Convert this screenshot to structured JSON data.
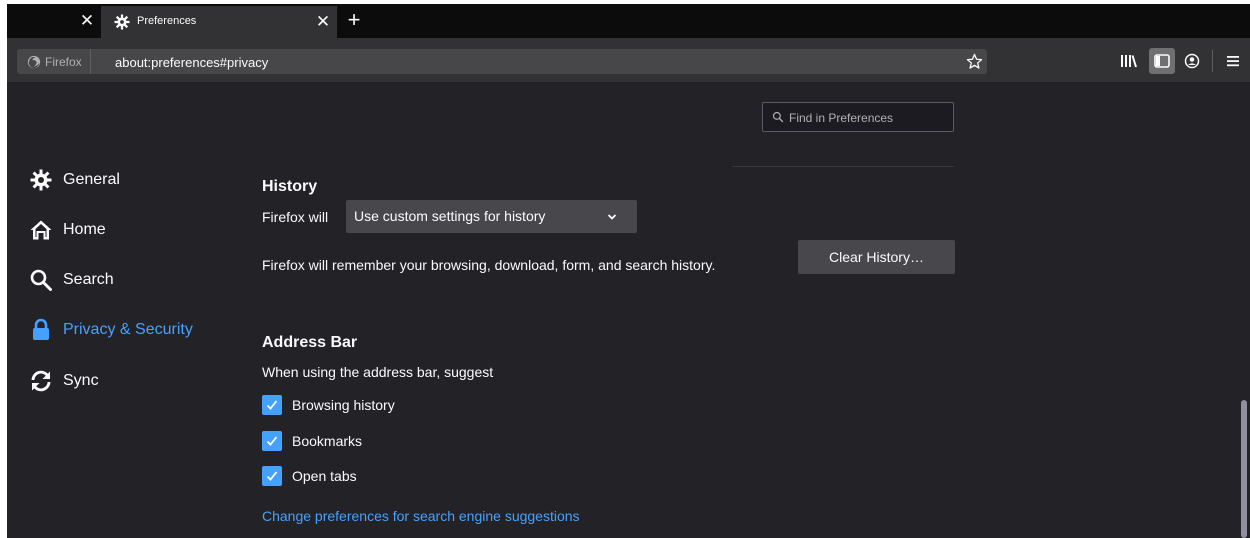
{
  "tabs": {
    "active_title": "Preferences"
  },
  "urlbar": {
    "identity_label": "Firefox",
    "url": "about:preferences#privacy"
  },
  "search": {
    "placeholder": "Find in Preferences"
  },
  "sidebar": {
    "items": [
      {
        "label": "General",
        "icon": "gear-icon"
      },
      {
        "label": "Home",
        "icon": "home-icon"
      },
      {
        "label": "Search",
        "icon": "search-icon"
      },
      {
        "label": "Privacy & Security",
        "icon": "lock-icon",
        "selected": true
      },
      {
        "label": "Sync",
        "icon": "sync-icon"
      }
    ]
  },
  "history": {
    "heading": "History",
    "firefox_will_label": "Firefox will",
    "mode_selected": "Use custom settings for history",
    "description": "Firefox will remember your browsing, download, form, and search history.",
    "clear_button": "Clear History…"
  },
  "address_bar": {
    "heading": "Address Bar",
    "intro": "When using the address bar, suggest",
    "options": [
      {
        "label": "Browsing history",
        "checked": true
      },
      {
        "label": "Bookmarks",
        "checked": true
      },
      {
        "label": "Open tabs",
        "checked": true
      }
    ],
    "link": "Change preferences for search engine suggestions"
  },
  "colors": {
    "accent": "#45a1ff",
    "background": "#232327",
    "toolbar": "#323234"
  }
}
